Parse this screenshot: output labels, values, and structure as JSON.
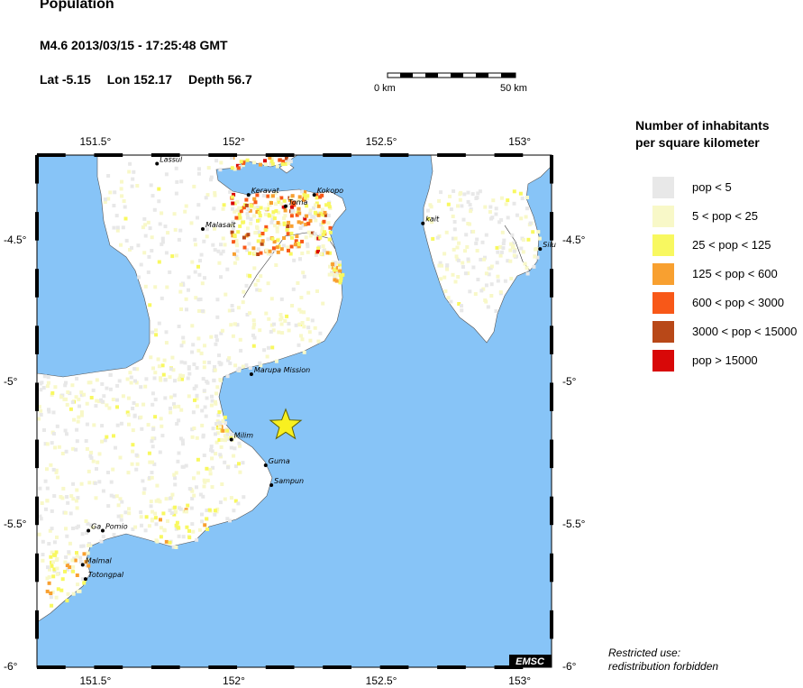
{
  "header": {
    "title": "Population",
    "event_line": "M4.6  2013/03/15 - 17:25:48 GMT",
    "lat": "Lat -5.15",
    "lon": "Lon 152.17",
    "depth": "Depth  56.7"
  },
  "scale_bar": {
    "start_label": "0 km",
    "end_label": "50 km"
  },
  "map": {
    "lon_range": [
      151.3,
      153.1
    ],
    "lat_range": [
      -6.0,
      -4.2
    ],
    "lon_ticks": [
      "151.5°",
      "152°",
      "152.5°",
      "153°"
    ],
    "lat_ticks": [
      "-4.5°",
      "-5°",
      "-5.5°",
      "-6°"
    ],
    "epicenter": {
      "lat": -5.15,
      "lon": 152.17
    },
    "sea_color": "#87c4f7",
    "land_color": "#ffffff",
    "places": [
      {
        "name": "Lassul",
        "lon": 151.72,
        "lat": -4.23
      },
      {
        "name": "Keravat",
        "lon": 152.04,
        "lat": -4.34
      },
      {
        "name": "Toma",
        "lon": 152.17,
        "lat": -4.38
      },
      {
        "name": "Kokopo",
        "lon": 152.27,
        "lat": -4.34
      },
      {
        "name": "Malasait",
        "lon": 151.88,
        "lat": -4.46
      },
      {
        "name": "kait",
        "lon": 152.65,
        "lat": -4.44
      },
      {
        "name": "Silu",
        "lon": 153.06,
        "lat": -4.53
      },
      {
        "name": "Marupa Mission",
        "lon": 152.05,
        "lat": -4.97
      },
      {
        "name": "Milim",
        "lon": 151.98,
        "lat": -5.2
      },
      {
        "name": "Guma",
        "lon": 152.1,
        "lat": -5.29
      },
      {
        "name": "Sampun",
        "lon": 152.12,
        "lat": -5.36
      },
      {
        "name": "Ga",
        "lon": 151.48,
        "lat": -5.52
      },
      {
        "name": "Pomio",
        "lon": 151.53,
        "lat": -5.52
      },
      {
        "name": "Malmal",
        "lon": 151.46,
        "lat": -5.64
      },
      {
        "name": "Totongpal",
        "lon": 151.47,
        "lat": -5.69
      }
    ],
    "watermark": "EMSC"
  },
  "legend": {
    "title_line1": "Number of inhabitants",
    "title_line2": "per square kilometer",
    "items": [
      {
        "label": "pop < 5",
        "color": "#e8e8e8"
      },
      {
        "label": "5 < pop < 25",
        "color": "#f8f8c8"
      },
      {
        "label": "25 < pop < 125",
        "color": "#f8f860"
      },
      {
        "label": "125 < pop < 600",
        "color": "#f8a030"
      },
      {
        "label": "600 < pop < 3000",
        "color": "#f85818"
      },
      {
        "label": "3000 < pop < 15000",
        "color": "#b84818"
      },
      {
        "label": "pop > 15000",
        "color": "#d80808"
      }
    ]
  },
  "footer": {
    "line1": "Restricted use:",
    "line2": "redistribution forbidden"
  }
}
